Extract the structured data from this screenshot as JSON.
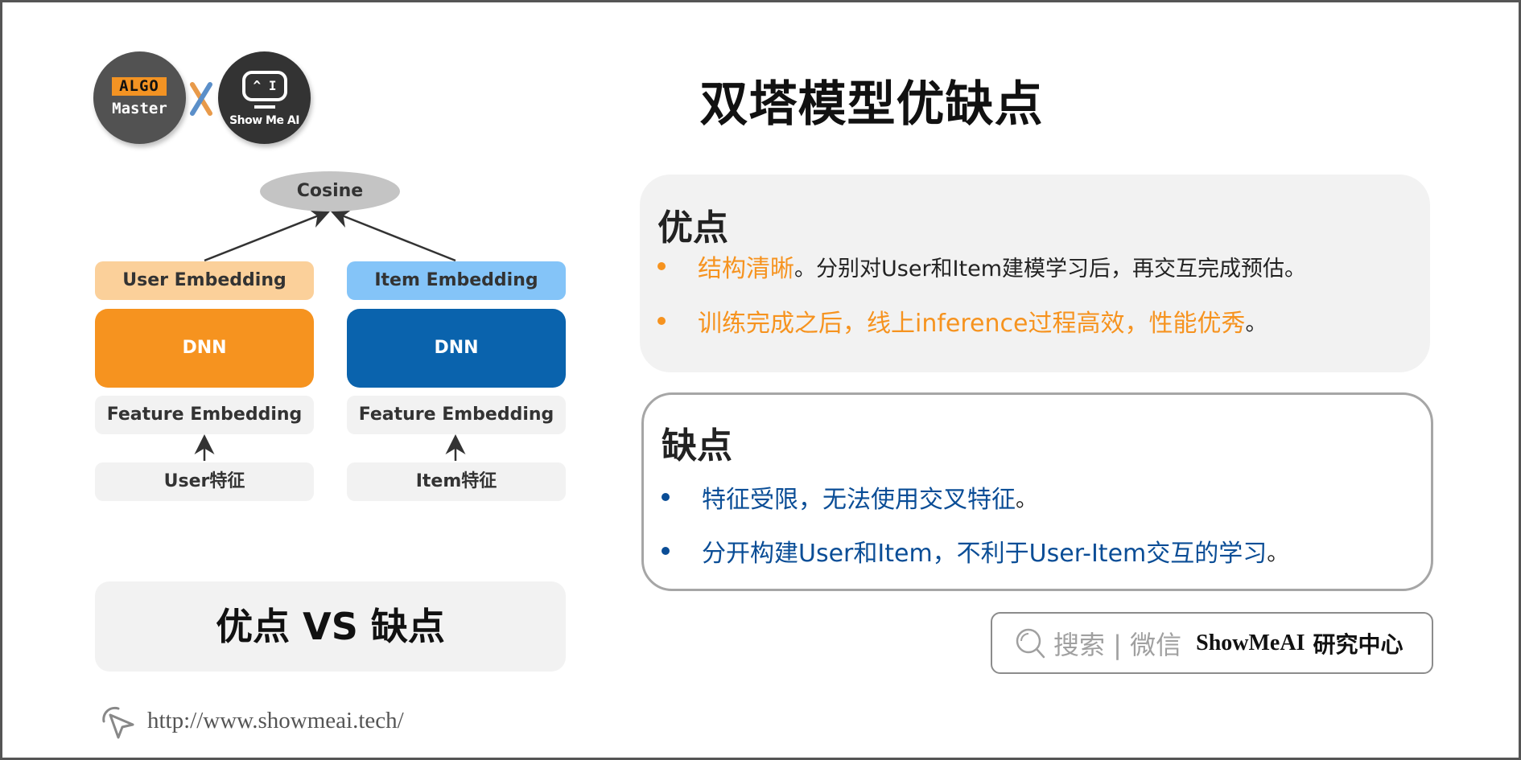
{
  "logos": {
    "left": {
      "badge": "ALGO",
      "text": "Master"
    },
    "separator": "x",
    "right": {
      "screen": "^ I",
      "text": "Show Me AI"
    }
  },
  "title": "双塔模型优缺点",
  "diagram": {
    "top_node": "Cosine",
    "user_tower": {
      "embedding": "User Embedding",
      "dnn": "DNN",
      "feature_embedding": "Feature Embedding",
      "input": "User特征"
    },
    "item_tower": {
      "embedding": "Item Embedding",
      "dnn": "DNN",
      "feature_embedding": "Feature Embedding",
      "input": "Item特征"
    },
    "colors": {
      "user_embedding": "#fbd09a",
      "item_embedding": "#84c4f8",
      "user_dnn": "#f6931f",
      "item_dnn": "#0a63ad",
      "neutral": "#f2f2f2",
      "cosine": "#c4c4c4"
    }
  },
  "vs_label": "优点 VS 缺点",
  "url": "http://www.showmeai.tech/",
  "pros": {
    "title": "优点",
    "items": [
      {
        "highlight": "结构清晰",
        "rest": "。分别对User和Item建模学习后，再交互完成预估。"
      },
      {
        "highlight": "训练完成之后，线上inference过程高效，性能优秀",
        "rest": "。"
      }
    ],
    "accent": "#f6931f"
  },
  "cons": {
    "title": "缺点",
    "items": [
      {
        "highlight": "特征受限，无法使用交叉特征",
        "rest": "。"
      },
      {
        "highlight": "分开构建User和Item，不利于User-Item交互的学习",
        "rest": "。"
      }
    ],
    "accent": "#0a4d96"
  },
  "search": {
    "icon": "search-icon",
    "label": "搜索 | 微信",
    "brand": "ShowMeAI",
    "brand_suffix": "研究中心"
  }
}
